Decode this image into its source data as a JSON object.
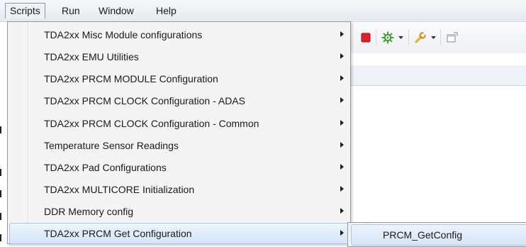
{
  "menubar": {
    "items": [
      {
        "label": "Scripts",
        "active": true
      },
      {
        "label": "Run"
      },
      {
        "label": "Window"
      },
      {
        "label": "Help"
      }
    ]
  },
  "toolbar": {
    "icons": [
      "stop-icon",
      "debug-gear-icon",
      "dropdown-arrow-icon",
      "wrench-icon",
      "dropdown-arrow-icon",
      "open-perspective-icon"
    ],
    "colors": {
      "stop": "#e0202a",
      "gear": "#3f9b2e",
      "wrench": "#e8b020"
    }
  },
  "scripts_menu": {
    "items": [
      {
        "label": "TDA2xx Misc Module configurations",
        "has_submenu": true
      },
      {
        "label": "TDA2xx EMU Utilities",
        "has_submenu": true
      },
      {
        "label": "TDA2xx PRCM MODULE Configuration",
        "has_submenu": true
      },
      {
        "label": "TDA2xx PRCM CLOCK Configuration - ADAS",
        "has_submenu": true
      },
      {
        "label": "TDA2xx PRCM CLOCK Configuration - Common",
        "has_submenu": true
      },
      {
        "label": "Temperature Sensor Readings",
        "has_submenu": true
      },
      {
        "label": "TDA2xx Pad Configurations",
        "has_submenu": true
      },
      {
        "label": "TDA2xx MULTICORE Initialization",
        "has_submenu": true
      },
      {
        "label": "DDR Memory config",
        "has_submenu": true
      },
      {
        "label": "TDA2xx PRCM Get Configuration",
        "has_submenu": true,
        "highlighted": true
      }
    ]
  },
  "submenu": {
    "items": [
      {
        "label": "PRCM_GetConfig",
        "highlighted": true
      }
    ]
  }
}
